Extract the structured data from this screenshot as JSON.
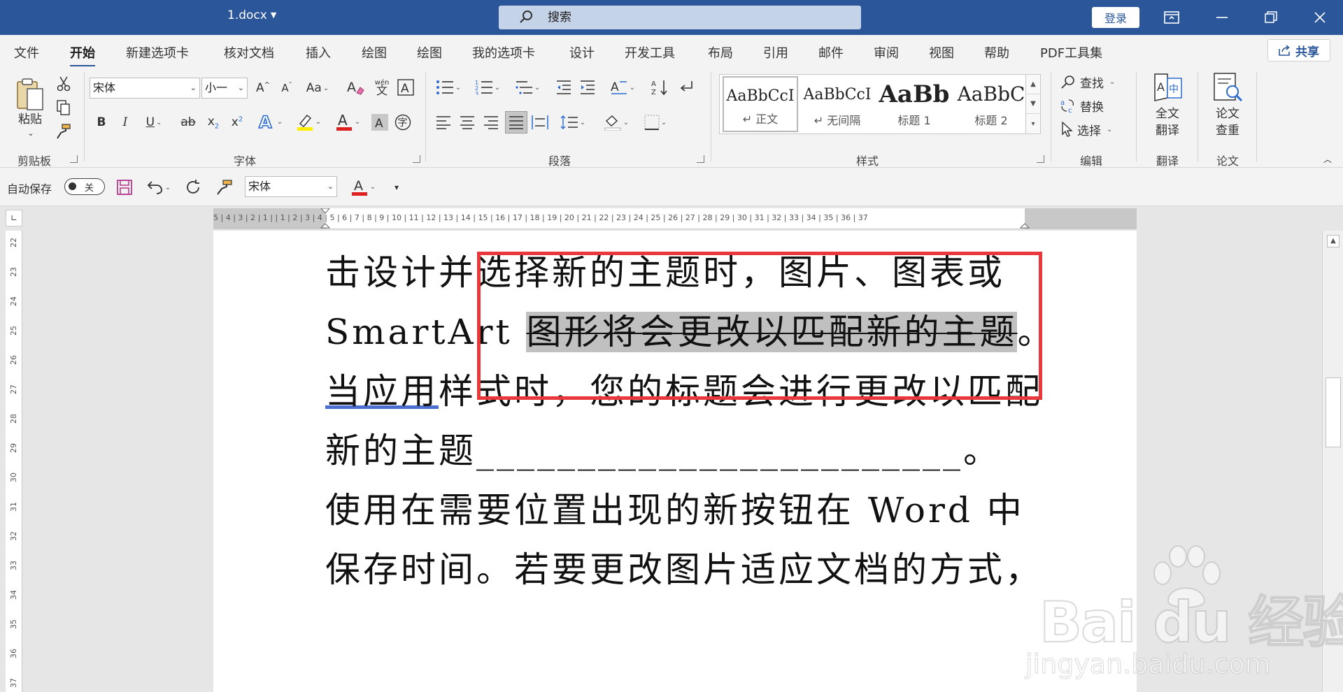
{
  "title_bar": {
    "doc_name": "1.docx",
    "search_placeholder": "搜索",
    "login_label": "登录"
  },
  "tabs": [
    "文件",
    "开始",
    "新建选项卡",
    "核对文档",
    "插入",
    "绘图",
    "绘图",
    "我的选项卡",
    "设计",
    "开发工具",
    "布局",
    "引用",
    "邮件",
    "审阅",
    "视图",
    "帮助",
    "PDF工具集"
  ],
  "active_tab": "开始",
  "share_label": "共享",
  "ribbon": {
    "clipboard": {
      "paste_label": "粘贴",
      "group_label": "剪贴板"
    },
    "font": {
      "font_name": "宋体",
      "font_size": "小一",
      "change_case": "Aa",
      "phonetic": "wén",
      "group_label": "字体"
    },
    "paragraph": {
      "group_label": "段落"
    },
    "styles": {
      "group_label": "样式",
      "items": [
        {
          "sample": "AaBbCcI",
          "name": "正文"
        },
        {
          "sample": "AaBbCcI",
          "name": "无间隔"
        },
        {
          "sample": "AaBb",
          "name": "标题 1"
        },
        {
          "sample": "AaBbC",
          "name": "标题 2"
        }
      ]
    },
    "editing": {
      "find": "查找",
      "replace": "替换",
      "select": "选择",
      "group_label": "编辑"
    },
    "translate": {
      "button_line1": "全文",
      "button_line2": "翻译",
      "group_label": "翻译"
    },
    "paper": {
      "button_line1": "论文",
      "button_line2": "查重",
      "group_label": "论文"
    }
  },
  "qat": {
    "autosave_label": "自动保存",
    "autosave_state": "关",
    "font_name": "宋体"
  },
  "ruler": {
    "h_numbers": "5 | 4 | 3 | 2 | 1 |   | 1 | 2 | 3 | 4 | 5 | 6 | 7 | 8 | 9 | 10 | 11 | 12 | 13 | 14 | 15 | 16 | 17 | 18 | 19 | 20 | 21 | 22 | 23 | 24 | 25 | 26 | 27 | 28 | 29 | 30 | 31 | 32 | 33 | 34 | 35 | 36 | 37",
    "v_numbers": [
      "22",
      "23",
      "24",
      "25",
      "26",
      "27",
      "28",
      "29",
      "30",
      "31",
      "32",
      "33",
      "34",
      "35",
      "36",
      "37"
    ]
  },
  "document": {
    "line1": "击设计并选择新的主题时，图片、图表或",
    "line2_prefix": "SmartArt ",
    "line2_strike": "图形将会更改以匹配新的主题",
    "line2_suffix": "。",
    "line3_underlined": "当应用",
    "line3_rest": "样式时，您的标题会进行更改以匹配",
    "line4": "新的主题________________________。",
    "line5": "使用在需要位置出现的新按钮在 Word 中",
    "line6": "保存时间。若要更改图片适应文档的方式，"
  },
  "watermark": {
    "brand": "Bai  du 经验",
    "url": "jingyan.baidu.com"
  },
  "colors": {
    "title_bar": "#2b579a",
    "highlight_box": "#e8383b",
    "strike_bg": "#c0c0c0"
  }
}
